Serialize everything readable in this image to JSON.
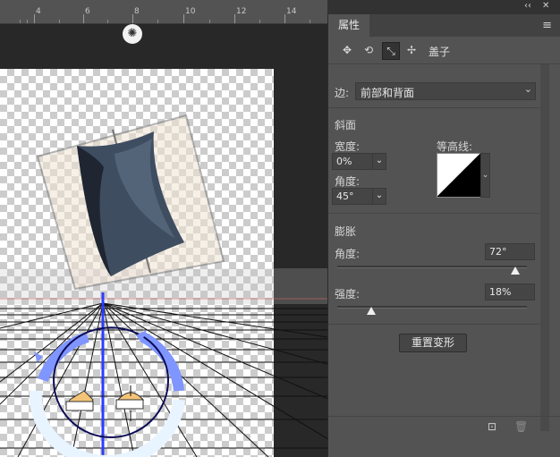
{
  "ruler": {
    "ticks": [
      "4",
      "6",
      "8",
      "10",
      "12",
      "14"
    ]
  },
  "window_controls": {
    "collapse": "‹‹",
    "close": "✕"
  },
  "panel": {
    "tab_label": "属性",
    "active_icon_caption": "盖子",
    "side_label": "边:",
    "side_value": "前部和背面",
    "bevel_heading": "斜面",
    "width_label": "宽度:",
    "width_value": "0%",
    "contour_label": "等高线:",
    "bevel_angle_label": "角度:",
    "bevel_angle_value": "45°",
    "inflate_heading": "膨胀",
    "inflate_angle_label": "角度:",
    "inflate_angle_value": "72°",
    "inflate_angle_level": 0.94,
    "strength_label": "强度:",
    "strength_value": "18%",
    "strength_level": 0.18,
    "reset_button": "重置变形"
  },
  "icons": {
    "panel_icons": [
      "mesh-icon",
      "deform-icon",
      "cap-icon",
      "coordinates-icon"
    ],
    "bottom": [
      "render-icon",
      "delete-icon"
    ],
    "light": "light-icon"
  },
  "colors": {
    "panel_bg": "#535353",
    "canvas_bg": "#282828",
    "accent_blue": "#2c3cff",
    "widget_blue": "#7f95ff"
  }
}
